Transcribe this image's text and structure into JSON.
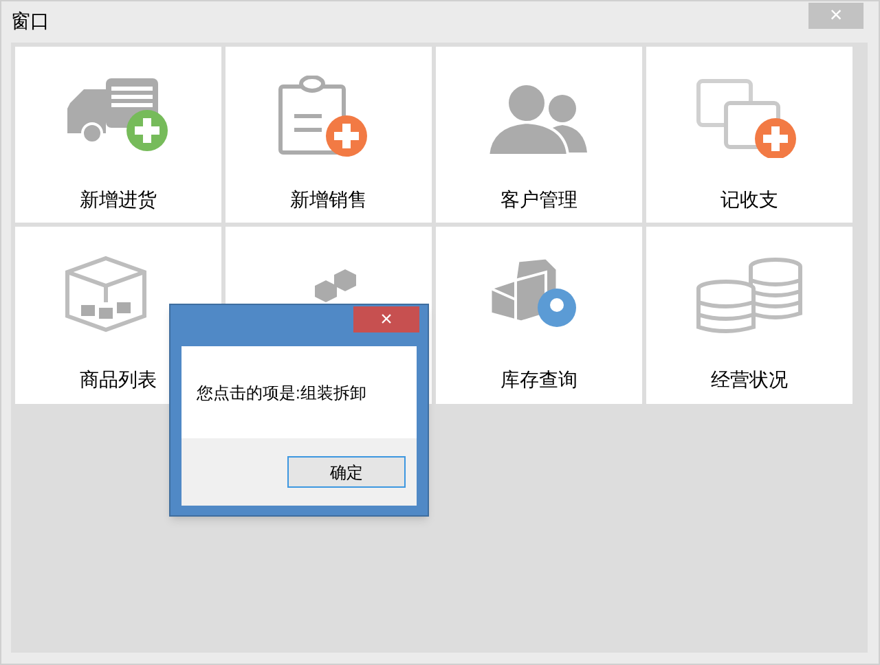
{
  "window": {
    "title": "窗口",
    "close": "×"
  },
  "tiles": [
    {
      "kind": "truck-add",
      "label": "新增进货"
    },
    {
      "kind": "clipboard-add",
      "label": "新增销售"
    },
    {
      "kind": "people",
      "label": "客户管理"
    },
    {
      "kind": "cards-add",
      "label": "记收支"
    },
    {
      "kind": "box",
      "label": "商品列表"
    },
    {
      "kind": "hexagons"
    },
    {
      "kind": "cubes",
      "label": "库存查询"
    },
    {
      "kind": "coins",
      "label": "经营状况"
    }
  ],
  "dialog": {
    "close": "×",
    "message": "您点击的项是:组装拆卸",
    "button": "确定"
  }
}
